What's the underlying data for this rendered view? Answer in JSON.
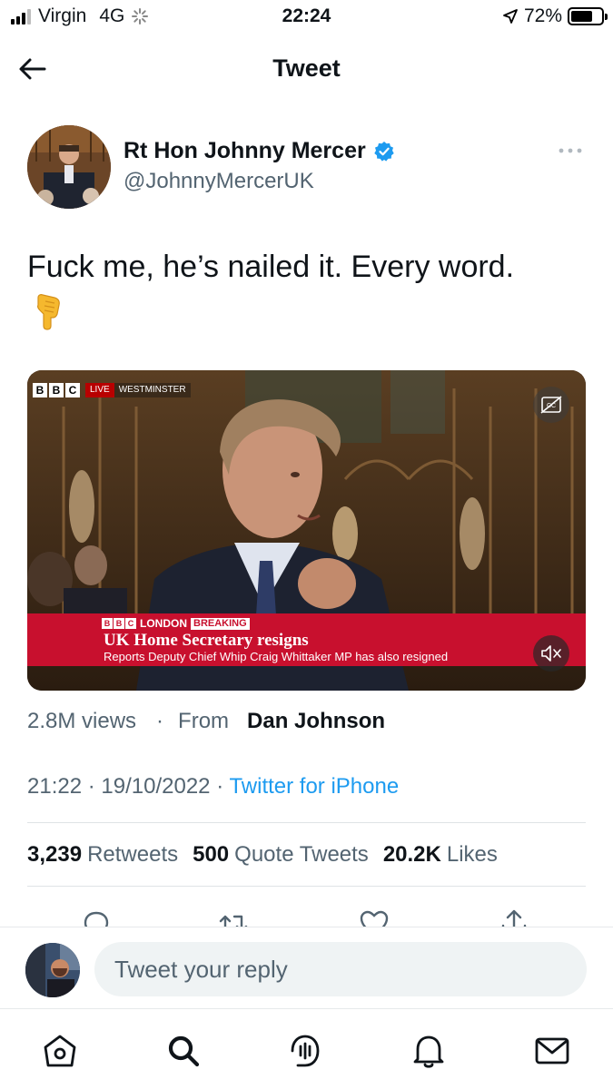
{
  "status_bar": {
    "carrier": "Virgin",
    "network": "4G",
    "time": "22:24",
    "battery": "72%",
    "battery_level": 0.72
  },
  "header": {
    "title": "Tweet"
  },
  "author": {
    "name": "Rt Hon Johnny Mercer",
    "handle": "@JohnnyMercerUK",
    "verified": true
  },
  "tweet": {
    "text": "Fuck me, he’s nailed it. Every word.",
    "emoji": "👇"
  },
  "media": {
    "broadcaster": "BBC",
    "blocks": [
      "B",
      "B",
      "C"
    ],
    "live_label": "LIVE",
    "location_label": "WESTMINSTER",
    "lower_third": {
      "region": "LONDON",
      "tag": "BREAKING",
      "headline": "UK Home Secretary resigns",
      "subline": "Reports Deputy Chief Whip Craig Whittaker MP has also resigned"
    }
  },
  "views": {
    "count": "2.8M views",
    "separator": "·",
    "from_label": "From",
    "from_name": "Dan Johnson"
  },
  "timestamp": {
    "time": "21:22",
    "sep1": "·",
    "date": "19/10/2022",
    "sep2": "·",
    "source": "Twitter for iPhone"
  },
  "stats": {
    "retweets_count": "3,239",
    "retweets_label": "Retweets",
    "quotes_count": "500",
    "quotes_label": "Quote Tweets",
    "likes_count": "20.2K",
    "likes_label": "Likes"
  },
  "reply": {
    "placeholder": "Tweet your reply"
  },
  "colors": {
    "accent": "#1d9bf0",
    "text": "#0f1419",
    "secondary": "#536471",
    "breaking_red": "#c8102e"
  },
  "icons": [
    "back-arrow-icon",
    "verified-badge-icon",
    "more-icon",
    "closed-captions-icon",
    "mute-icon",
    "reply-icon",
    "retweet-icon",
    "like-icon",
    "share-icon",
    "home-icon",
    "search-icon",
    "spaces-icon",
    "notifications-icon",
    "messages-icon"
  ]
}
